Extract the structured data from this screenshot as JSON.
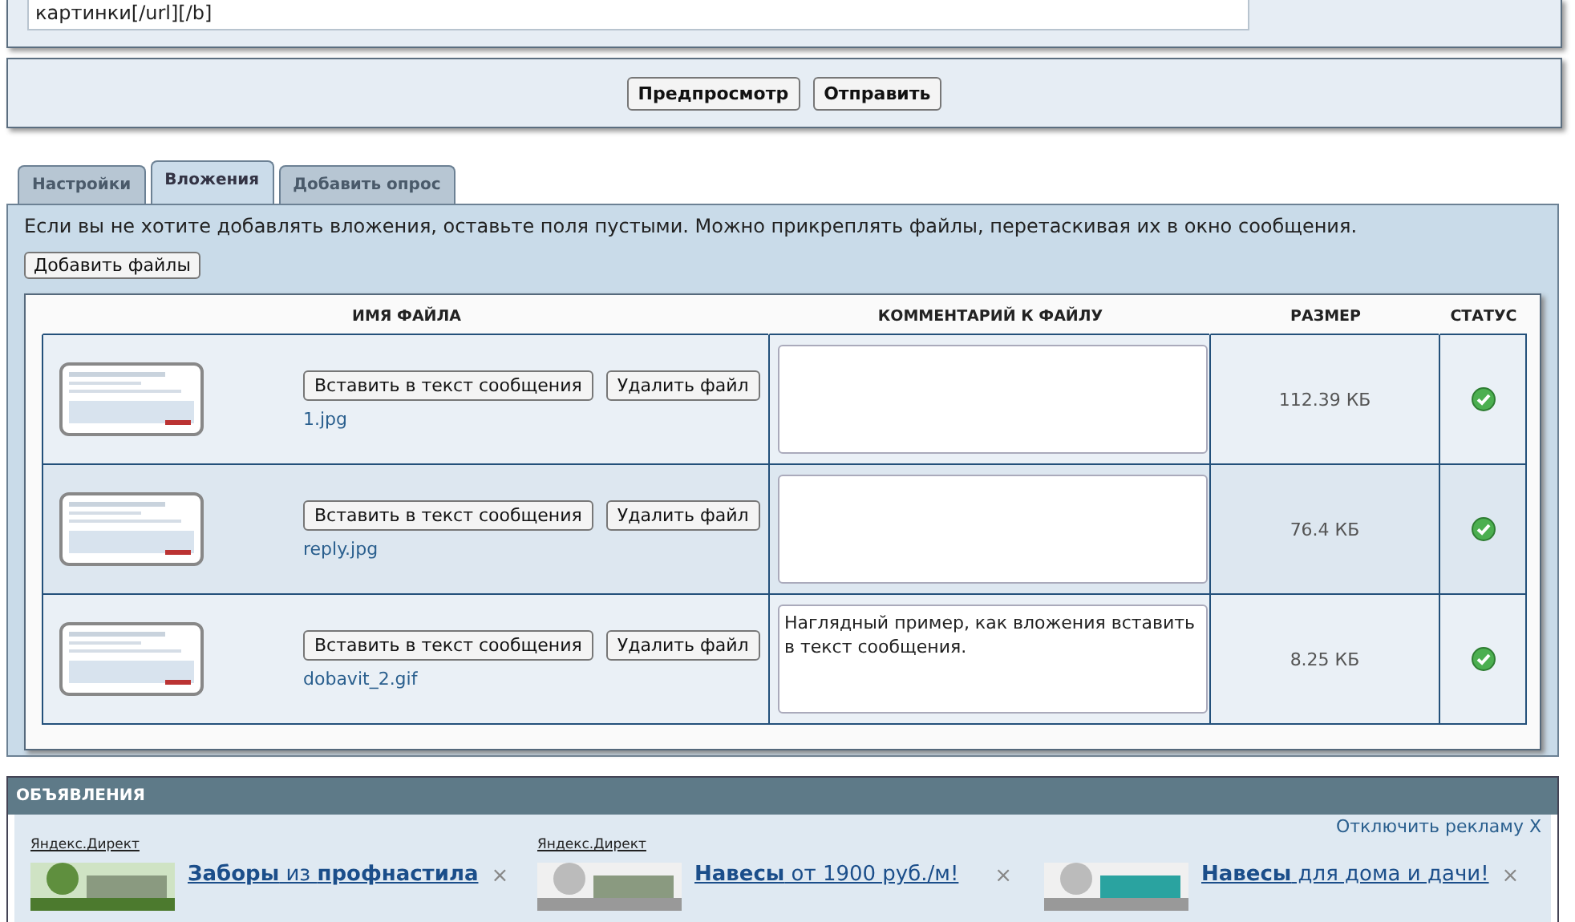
{
  "message_field": {
    "value": "картинки[/url][/b]"
  },
  "actions": [
    "Предпросмотр",
    "Отправить"
  ],
  "tabs": [
    {
      "label": "Настройки",
      "selected": false
    },
    {
      "label": "Вложения",
      "selected": true
    },
    {
      "label": "Добавить опрос",
      "selected": false
    }
  ],
  "attachments": {
    "hint": "Если вы не хотите добавлять вложения, оставьте поля пустыми. Можно прикреплять файлы, перетаскивая их в окно сообщения.",
    "add_button": "Добавить файлы",
    "table": {
      "columns": [
        "ИМЯ ФАЙЛА",
        "КОММЕНТАРИЙ К ФАЙЛУ",
        "РАЗМЕР",
        "СТАТУС"
      ],
      "rows": [
        {
          "insert_button": "Вставить в текст сообщения",
          "delete_button": "Удалить файл",
          "file": "1.jpg",
          "comment": "",
          "size": "112.39 КБ",
          "uploaded": true
        },
        {
          "insert_button": "Вставить в текст сообщения",
          "delete_button": "Удалить файл",
          "file": "reply.jpg",
          "comment": "",
          "size": "76.4 КБ",
          "uploaded": true
        },
        {
          "insert_button": "Вставить в текст сообщения",
          "delete_button": "Удалить файл",
          "file": "dobavit_2.gif",
          "comment": "Наглядный пример, как вложения вставить в текст сообщения.",
          "size": "8.25 КБ",
          "uploaded": true
        }
      ]
    }
  },
  "ads": {
    "title": "ОБЪЯВЛЕНИЯ",
    "disable_link": "Отключить рекламу X",
    "items": [
      {
        "source": "Яндекс.Директ",
        "title": "**Заборы** из **профнастила**",
        "close": "×"
      },
      {
        "source": "Яндекс.Директ",
        "title": "**Навесы** от 1900 руб./м!",
        "close": "×"
      },
      {
        "title": "**Навесы** для дома и дачи!",
        "close": "×"
      }
    ]
  }
}
